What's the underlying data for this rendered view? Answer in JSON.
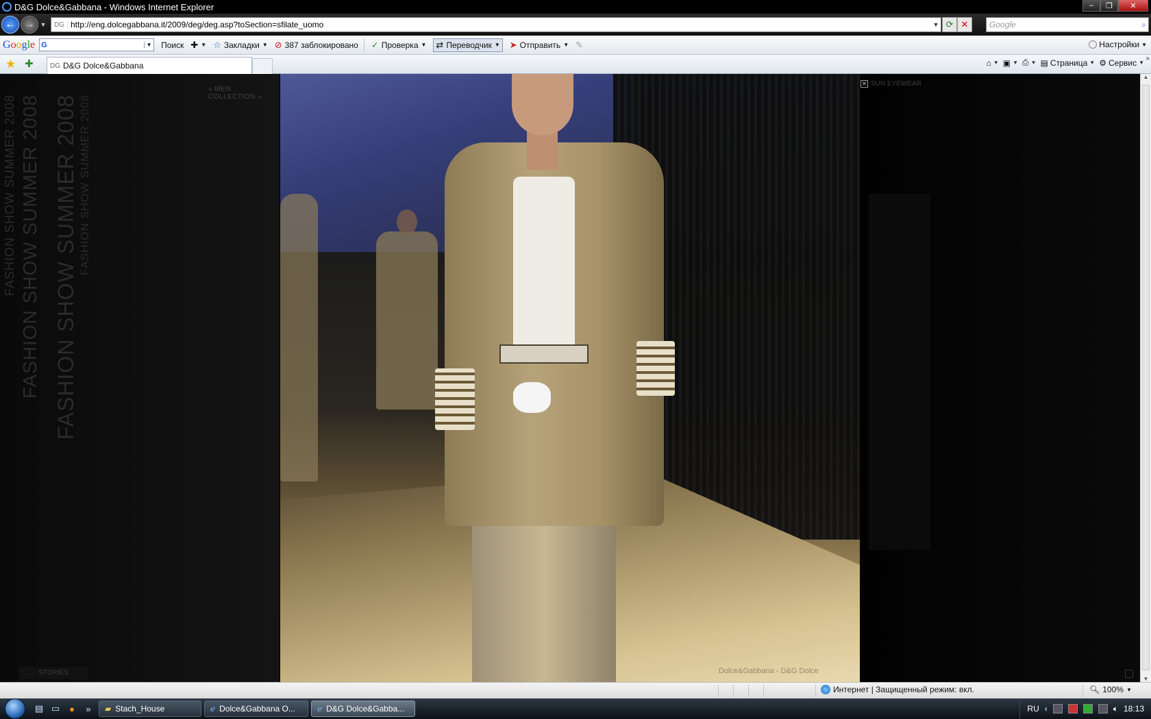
{
  "window": {
    "title": "D&G Dolce&Gabbana - Windows Internet Explorer"
  },
  "address_bar": {
    "favicon": "DG",
    "url": "http://eng.dolcegabbana.it/2009/deg/deg.asp?toSection=sfilate_uomo"
  },
  "search_box": {
    "placeholder": "Google"
  },
  "google_toolbar": {
    "logo": [
      "G",
      "o",
      "o",
      "g",
      "l",
      "e"
    ],
    "search_button": "Поиск",
    "bookmarks": "Закладки",
    "blocked": "387 заблокировано",
    "spellcheck": "Проверка",
    "translate": "Переводчик",
    "send": "Отправить",
    "settings": "Настройки"
  },
  "tabs": [
    {
      "favicon": "DG",
      "label": "D&G Dolce&Gabbana"
    }
  ],
  "command_bar": {
    "page": "Страница",
    "tools": "Сервис"
  },
  "page": {
    "side_text": "FASHION SHOW SUMMER 2008",
    "nav_prev": "MEN COLLECTION",
    "nav_next": "SUN EYEWEAR",
    "stories": "STORIES",
    "caption": "Dolce&Gabbana - D&G Dolce"
  },
  "status_bar": {
    "zone": "Интернет | Защищенный режим: вкл.",
    "zoom": "100%"
  },
  "taskbar": {
    "items": [
      {
        "label": "Stach_House",
        "icon": "folder-icon",
        "active": false
      },
      {
        "label": "Dolce&Gabbana O...",
        "icon": "ie-icon",
        "active": false
      },
      {
        "label": "D&G Dolce&Gabba...",
        "icon": "ie-icon",
        "active": true
      }
    ],
    "language": "RU",
    "clock": "18:13"
  },
  "colors": {
    "title_bar": "#000000",
    "toolbar": "#e3e8ef",
    "taskbar": "#1a242c",
    "page_bg": "#000000"
  }
}
